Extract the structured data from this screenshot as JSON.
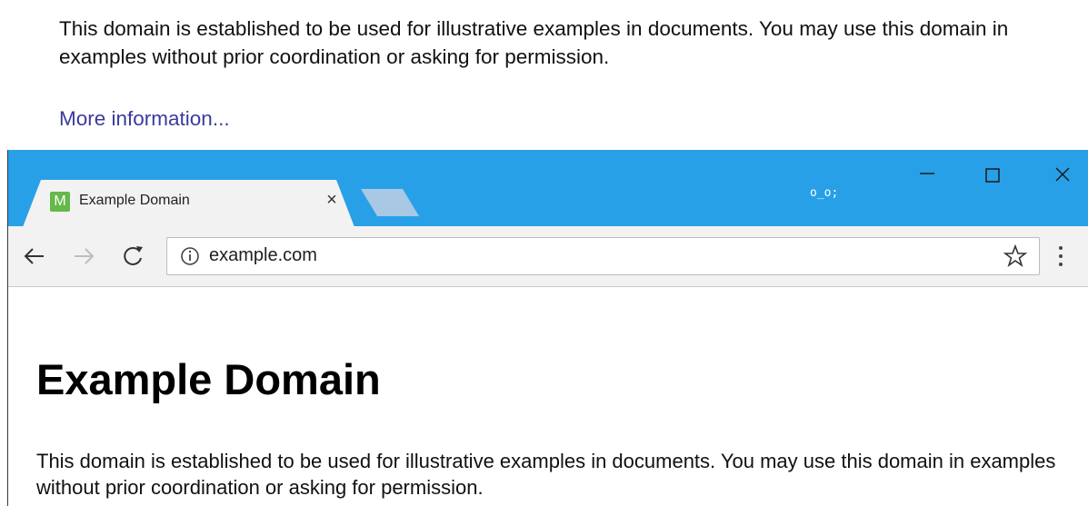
{
  "background_page": {
    "paragraph": "This domain is established to be used for illustrative examples in documents. You may use this domain in examples without prior coordination or asking for permission.",
    "link": "More information..."
  },
  "browser": {
    "tab": {
      "favicon_letter": "M",
      "title": "Example Domain",
      "close_glyph": "×"
    },
    "profile_label": "o_o;",
    "address_bar": {
      "url": "example.com"
    },
    "colors": {
      "titlebar": "#28a0e8",
      "favicon": "#65b84a",
      "link": "#3b3b9c"
    }
  },
  "page": {
    "heading": "Example Domain",
    "paragraph": "This domain is established to be used for illustrative examples in documents. You may use this domain in examples without prior coordination or asking for permission."
  }
}
